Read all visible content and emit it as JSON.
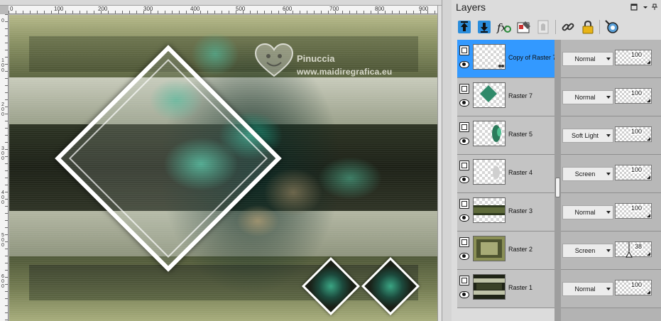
{
  "window": {
    "ruler_top_labels": [
      "0",
      "100",
      "200",
      "300",
      "400",
      "500",
      "600",
      "700",
      "800",
      "900"
    ],
    "ruler_left_labels": [
      "0",
      "1\n0\n0",
      "2\n0\n0",
      "3\n0\n0",
      "4\n0\n0",
      "5\n0\n0",
      "6\n0\n0"
    ]
  },
  "artwork": {
    "watermark_name": "Pinuccia",
    "watermark_url": "www.maidiregrafica.eu"
  },
  "layers_panel": {
    "title": "Layers",
    "toolbar_icons": [
      "move-layer-up-icon",
      "move-layer-down-icon",
      "fx-effects-icon",
      "edit-selection-icon",
      "mask-icon",
      "link-icon",
      "lock-icon",
      "locate-layer-icon"
    ],
    "layers": [
      {
        "name": "Copy of Raster 7",
        "blend_mode": "Normal",
        "opacity": "100",
        "selected": true
      },
      {
        "name": "Raster 7",
        "blend_mode": "Normal",
        "opacity": "100",
        "selected": false
      },
      {
        "name": "Raster 5",
        "blend_mode": "Soft Light",
        "opacity": "100",
        "selected": false
      },
      {
        "name": "Raster 4",
        "blend_mode": "Screen",
        "opacity": "100",
        "selected": false
      },
      {
        "name": "Raster 3",
        "blend_mode": "Normal",
        "opacity": "100",
        "selected": false
      },
      {
        "name": "Raster 2",
        "blend_mode": "Screen",
        "opacity": "38",
        "selected": false
      },
      {
        "name": "Raster 1",
        "blend_mode": "Normal",
        "opacity": "100",
        "selected": false
      }
    ]
  },
  "colors": {
    "selection": "#3399ff",
    "panel_bg": "#dcdcdc",
    "toolbar_accent": "#1e90ff"
  }
}
